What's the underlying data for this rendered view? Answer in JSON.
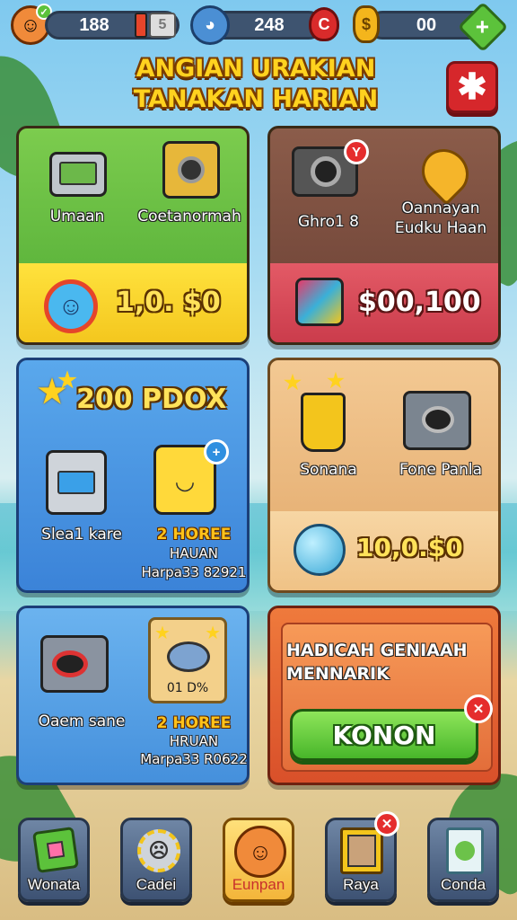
{
  "topbar": {
    "coins": "188",
    "energy_badge": "5",
    "gems": "248",
    "tokens": "00"
  },
  "title": {
    "line1": "ANGIAN URAKIAN",
    "line2": "TANAKAN HARIAN"
  },
  "panels": {
    "green": {
      "item1_label": "Umaan",
      "item2_label": "Coetanormah",
      "price": "1,0. $0"
    },
    "red": {
      "item1_label": "Ghro1 8",
      "item2_label_line1": "Oannayan",
      "item2_label_line2": "Eudku Haan",
      "price": "$00,100"
    },
    "blue1": {
      "header": "200 PDOX",
      "item1_label": "Slea1 kare",
      "item2_title": "2 HOREE",
      "item2_line2": "HAUAN",
      "item2_line3": "Harpa33 82921"
    },
    "tan": {
      "item1_label": "Sonana",
      "item2_label": "Fone Panla",
      "price": "10,0.$0"
    },
    "blue2": {
      "item1_label": "Oaem sane",
      "item2_percent": "01 D%",
      "item2_title": "2 HOREE",
      "item2_line2": "HRUAN",
      "item2_line3": "Marpa33 R0622"
    },
    "promo": {
      "headline_line1": "HADICAH  GENIAAH",
      "headline_line2": "MENNARIK",
      "button_label": "KONON"
    }
  },
  "nav": [
    {
      "label": "Wonata"
    },
    {
      "label": "Cadei"
    },
    {
      "label": "Eunpan"
    },
    {
      "label": "Raya"
    },
    {
      "label": "Conda"
    }
  ]
}
